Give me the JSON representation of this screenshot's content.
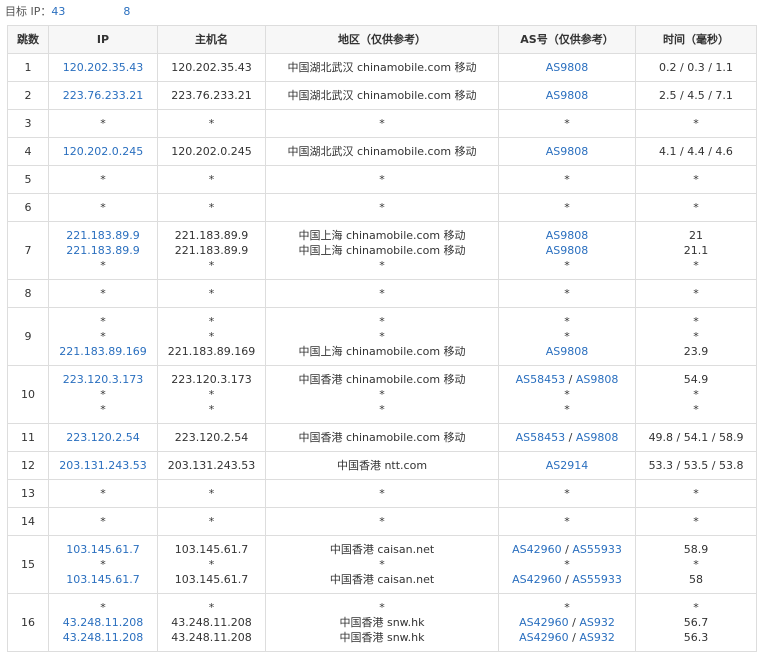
{
  "target": {
    "label": "目标 IP：",
    "ip_visible_start": "43",
    "ip_visible_end": "8"
  },
  "columns": [
    "跳数",
    "IP",
    "主机名",
    "地区（仅供参考）",
    "AS号（仅供参考）",
    "时间（毫秒）"
  ],
  "hops": [
    {
      "hop": "1",
      "lines": [
        {
          "ip": "120.202.35.43",
          "host": "120.202.35.43",
          "region": "中国湖北武汉 chinamobile.com 移动",
          "as": [
            "AS9808"
          ],
          "time": "0.2 / 0.3 / 1.1"
        }
      ]
    },
    {
      "hop": "2",
      "lines": [
        {
          "ip": "223.76.233.21",
          "host": "223.76.233.21",
          "region": "中国湖北武汉 chinamobile.com 移动",
          "as": [
            "AS9808"
          ],
          "time": "2.5 / 4.5 / 7.1"
        }
      ]
    },
    {
      "hop": "3",
      "lines": [
        {
          "ip": "*",
          "host": "*",
          "region": "*",
          "as": [],
          "time": "*"
        }
      ]
    },
    {
      "hop": "4",
      "lines": [
        {
          "ip": "120.202.0.245",
          "host": "120.202.0.245",
          "region": "中国湖北武汉 chinamobile.com 移动",
          "as": [
            "AS9808"
          ],
          "time": "4.1 / 4.4 / 4.6"
        }
      ]
    },
    {
      "hop": "5",
      "lines": [
        {
          "ip": "*",
          "host": "*",
          "region": "*",
          "as": [],
          "time": "*"
        }
      ]
    },
    {
      "hop": "6",
      "lines": [
        {
          "ip": "*",
          "host": "*",
          "region": "*",
          "as": [],
          "time": "*"
        }
      ]
    },
    {
      "hop": "7",
      "lines": [
        {
          "ip": "221.183.89.9",
          "host": "221.183.89.9",
          "region": "中国上海 chinamobile.com 移动",
          "as": [
            "AS9808"
          ],
          "time": "21"
        },
        {
          "ip": "221.183.89.9",
          "host": "221.183.89.9",
          "region": "中国上海 chinamobile.com 移动",
          "as": [
            "AS9808"
          ],
          "time": "21.1"
        },
        {
          "ip": "*",
          "host": "*",
          "region": "*",
          "as": [],
          "time": "*"
        }
      ]
    },
    {
      "hop": "8",
      "lines": [
        {
          "ip": "*",
          "host": "*",
          "region": "*",
          "as": [],
          "time": "*"
        }
      ]
    },
    {
      "hop": "9",
      "lines": [
        {
          "ip": "*",
          "host": "*",
          "region": "*",
          "as": [],
          "time": "*"
        },
        {
          "ip": "*",
          "host": "*",
          "region": "*",
          "as": [],
          "time": "*"
        },
        {
          "ip": "221.183.89.169",
          "host": "221.183.89.169",
          "region": "中国上海 chinamobile.com 移动",
          "as": [
            "AS9808"
          ],
          "time": "23.9"
        }
      ]
    },
    {
      "hop": "10",
      "lines": [
        {
          "ip": "223.120.3.173",
          "host": "223.120.3.173",
          "region": "中国香港 chinamobile.com 移动",
          "as": [
            "AS58453",
            "AS9808"
          ],
          "time": "54.9"
        },
        {
          "ip": "*",
          "host": "*",
          "region": "*",
          "as": [],
          "time": "*"
        },
        {
          "ip": "*",
          "host": "*",
          "region": "*",
          "as": [],
          "time": "*"
        }
      ]
    },
    {
      "hop": "11",
      "lines": [
        {
          "ip": "223.120.2.54",
          "host": "223.120.2.54",
          "region": "中国香港 chinamobile.com 移动",
          "as": [
            "AS58453",
            "AS9808"
          ],
          "time": "49.8 / 54.1 / 58.9"
        }
      ]
    },
    {
      "hop": "12",
      "lines": [
        {
          "ip": "203.131.243.53",
          "host": "203.131.243.53",
          "region": "中国香港 ntt.com",
          "as": [
            "AS2914"
          ],
          "time": "53.3 / 53.5 / 53.8"
        }
      ]
    },
    {
      "hop": "13",
      "lines": [
        {
          "ip": "*",
          "host": "*",
          "region": "*",
          "as": [],
          "time": "*"
        }
      ]
    },
    {
      "hop": "14",
      "lines": [
        {
          "ip": "*",
          "host": "*",
          "region": "*",
          "as": [],
          "time": "*"
        }
      ]
    },
    {
      "hop": "15",
      "lines": [
        {
          "ip": "103.145.61.7",
          "host": "103.145.61.7",
          "region": "中国香港 caisan.net",
          "as": [
            "AS42960",
            "AS55933"
          ],
          "time": "58.9"
        },
        {
          "ip": "*",
          "host": "*",
          "region": "*",
          "as": [],
          "time": "*"
        },
        {
          "ip": "103.145.61.7",
          "host": "103.145.61.7",
          "region": "中国香港 caisan.net",
          "as": [
            "AS42960",
            "AS55933"
          ],
          "time": "58"
        }
      ]
    },
    {
      "hop": "16",
      "lines": [
        {
          "ip": "*",
          "host": "*",
          "region": "*",
          "as": [],
          "time": "*"
        },
        {
          "ip": "43.248.11.208",
          "host": "43.248.11.208",
          "region": "中国香港 snw.hk",
          "as": [
            "AS42960",
            "AS932"
          ],
          "time": "56.7"
        },
        {
          "ip": "43.248.11.208",
          "host": "43.248.11.208",
          "region": "中国香港 snw.hk",
          "as": [
            "AS42960",
            "AS932"
          ],
          "time": "56.3"
        }
      ]
    }
  ],
  "colors": {
    "link": "#2a6fbf",
    "border": "#dddddd",
    "header_bg": "#f7f7f7",
    "text": "#333333"
  }
}
